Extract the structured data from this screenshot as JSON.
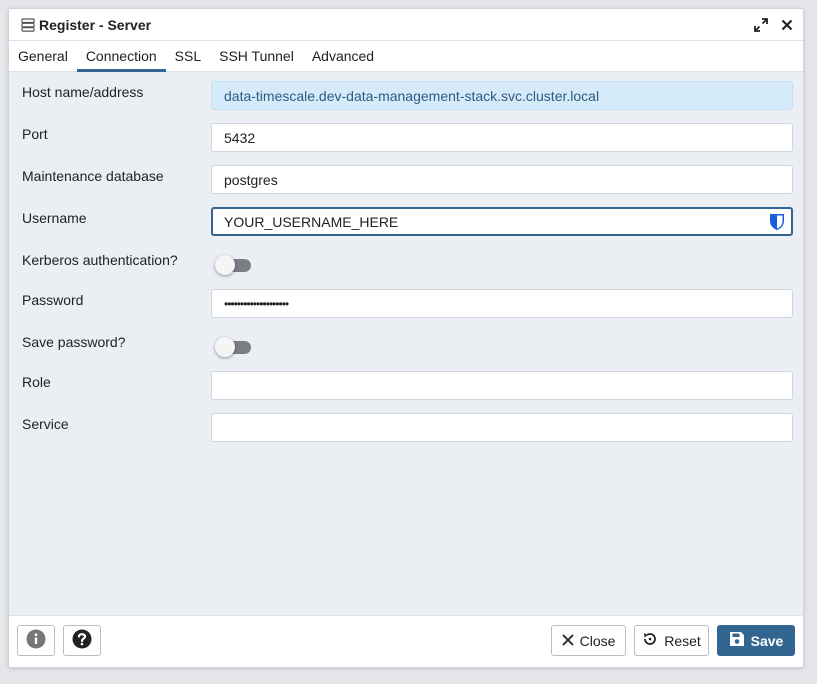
{
  "dialog": {
    "title": "Register - Server",
    "icons": {
      "title": "server-icon",
      "expand": "expand-icon",
      "close": "close-icon"
    }
  },
  "tabs": [
    {
      "label": "General",
      "active": false
    },
    {
      "label": "Connection",
      "active": true
    },
    {
      "label": "SSL",
      "active": false
    },
    {
      "label": "SSH Tunnel",
      "active": false
    },
    {
      "label": "Advanced",
      "active": false
    }
  ],
  "form": {
    "host": {
      "label": "Host name/address",
      "value": "data-timescale.dev-data-management-stack.svc.cluster.local"
    },
    "port": {
      "label": "Port",
      "value": "5432"
    },
    "maintenance_db": {
      "label": "Maintenance database",
      "value": "postgres"
    },
    "username": {
      "label": "Username",
      "value": "YOUR_USERNAME_HERE"
    },
    "kerberos": {
      "label": "Kerberos authentication?",
      "enabled": false
    },
    "password": {
      "label": "Password",
      "value": "••••••••••••••••••••"
    },
    "save_password": {
      "label": "Save password?",
      "enabled": false
    },
    "role": {
      "label": "Role",
      "value": ""
    },
    "service": {
      "label": "Service",
      "value": ""
    }
  },
  "footer": {
    "info_icon": "info-icon",
    "help_icon": "help-icon",
    "close_label": "Close",
    "reset_label": "Reset",
    "save_label": "Save"
  },
  "colors": {
    "accent": "#326690",
    "readonly_bg": "#d5ebfa"
  }
}
